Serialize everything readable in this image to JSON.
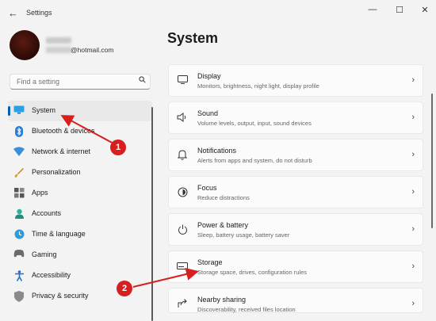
{
  "window": {
    "back_glyph": "←",
    "title": "Settings",
    "min_glyph": "—",
    "max_glyph": "☐",
    "close_glyph": "✕"
  },
  "account": {
    "email": "@hotmail.com"
  },
  "search": {
    "placeholder": "Find a setting",
    "icon": "search-icon"
  },
  "sidebar": {
    "items": [
      {
        "label": "System",
        "icon": "monitor-icon",
        "active": true
      },
      {
        "label": "Bluetooth & devices",
        "icon": "bluetooth-icon"
      },
      {
        "label": "Network & internet",
        "icon": "wifi-icon"
      },
      {
        "label": "Personalization",
        "icon": "brush-icon"
      },
      {
        "label": "Apps",
        "icon": "apps-icon"
      },
      {
        "label": "Accounts",
        "icon": "person-icon"
      },
      {
        "label": "Time & language",
        "icon": "globe-clock-icon"
      },
      {
        "label": "Gaming",
        "icon": "controller-icon"
      },
      {
        "label": "Accessibility",
        "icon": "accessibility-icon"
      },
      {
        "label": "Privacy & security",
        "icon": "shield-icon"
      }
    ]
  },
  "main": {
    "title": "System",
    "cards": [
      {
        "title": "Display",
        "subtitle": "Monitors, brightness, night light, display profile",
        "icon": "display-icon"
      },
      {
        "title": "Sound",
        "subtitle": "Volume levels, output, input, sound devices",
        "icon": "speaker-icon"
      },
      {
        "title": "Notifications",
        "subtitle": "Alerts from apps and system, do not disturb",
        "icon": "bell-icon"
      },
      {
        "title": "Focus",
        "subtitle": "Reduce distractions",
        "icon": "focus-icon"
      },
      {
        "title": "Power & battery",
        "subtitle": "Sleep, battery usage, battery saver",
        "icon": "power-icon"
      },
      {
        "title": "Storage",
        "subtitle": "Storage space, drives, configuration rules",
        "icon": "storage-icon"
      },
      {
        "title": "Nearby sharing",
        "subtitle": "Discoverability, received files location",
        "icon": "share-icon"
      }
    ],
    "chevron": "›"
  },
  "annotations": {
    "badge_1": "1",
    "badge_2": "2",
    "color": "#d81f1f"
  },
  "colors": {
    "accent": "#005fb8",
    "background": "#f3f3f3",
    "card": "#fbfbfb"
  }
}
